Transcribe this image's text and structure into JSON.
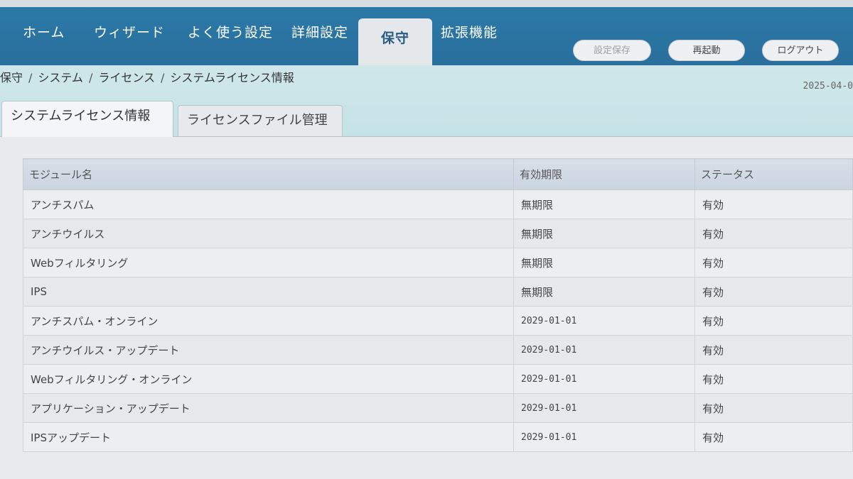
{
  "nav": {
    "items": [
      {
        "label": "ホーム"
      },
      {
        "label": "ウィザード"
      },
      {
        "label": "よく使う設定"
      },
      {
        "label": "詳細設定"
      },
      {
        "label": "保守"
      },
      {
        "label": "拡張機能"
      }
    ],
    "active_index": 4,
    "buttons": {
      "save": "設定保存",
      "restart": "再起動",
      "logout": "ログアウト"
    }
  },
  "breadcrumb": [
    "保守",
    "システム",
    "ライセンス",
    "システムライセンス情報"
  ],
  "date": "2025-04-0",
  "tabs": [
    {
      "label": "システムライセンス情報",
      "active": true
    },
    {
      "label": "ライセンスファイル管理",
      "active": false
    }
  ],
  "table": {
    "headers": [
      "モジュール名",
      "有効期限",
      "ステータス"
    ],
    "rows": [
      {
        "module": "アンチスパム",
        "expiry": "無期限",
        "status": "有効"
      },
      {
        "module": "アンチウイルス",
        "expiry": "無期限",
        "status": "有効"
      },
      {
        "module": "Webフィルタリング",
        "expiry": "無期限",
        "status": "有効"
      },
      {
        "module": "IPS",
        "expiry": "無期限",
        "status": "有効"
      },
      {
        "module": "アンチスパム・オンライン",
        "expiry": "2029-01-01",
        "status": "有効"
      },
      {
        "module": "アンチウイルス・アップデート",
        "expiry": "2029-01-01",
        "status": "有効"
      },
      {
        "module": "Webフィルタリング・オンライン",
        "expiry": "2029-01-01",
        "status": "有効"
      },
      {
        "module": "アプリケーション・アップデート",
        "expiry": "2029-01-01",
        "status": "有効"
      },
      {
        "module": "IPSアップデート",
        "expiry": "2029-01-01",
        "status": "有効"
      }
    ]
  },
  "colors": {
    "nav_bg": "#2a6f9c",
    "breadcrumb_bg": "#c4e2e6",
    "header_bg": "#cbd5e0"
  }
}
